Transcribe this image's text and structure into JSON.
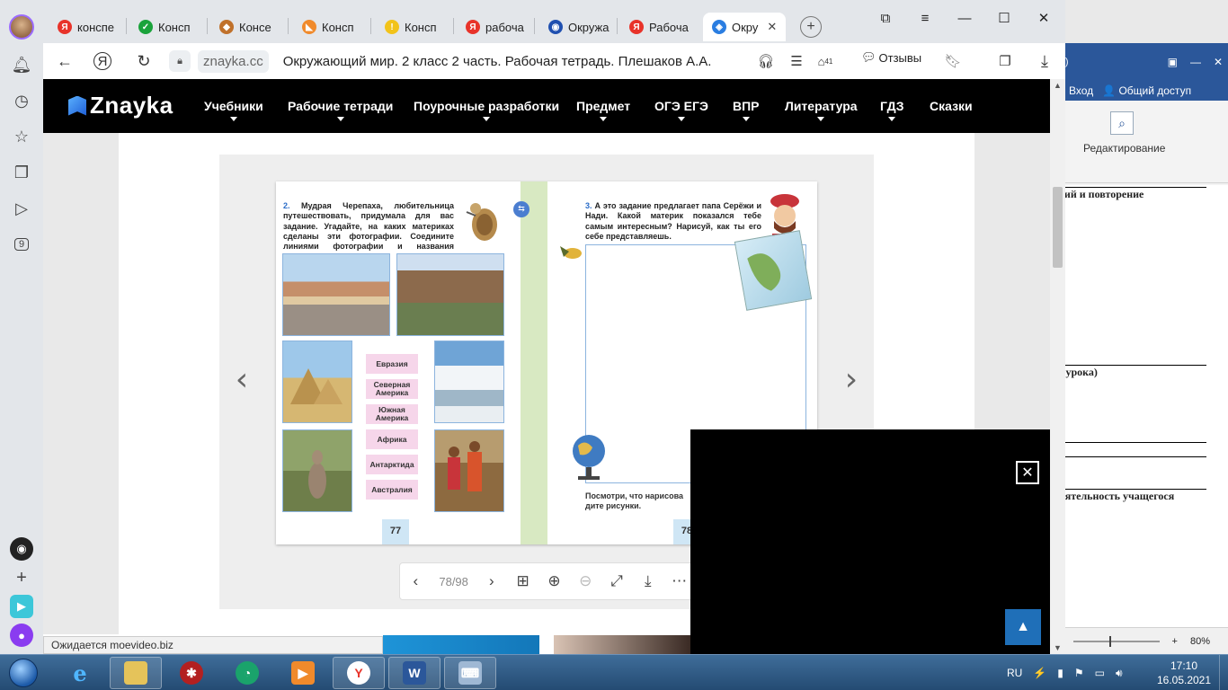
{
  "sidebar": {
    "badge_count": "9"
  },
  "tabs": [
    {
      "label": "конспе",
      "fav_color": "#e8332a",
      "fav_glyph": "Я"
    },
    {
      "label": "Консп",
      "fav_color": "#1aa33b",
      "fav_glyph": "✓"
    },
    {
      "label": "Консе",
      "fav_color": "#c0712b",
      "fav_glyph": "◆"
    },
    {
      "label": "Консп",
      "fav_color": "#f08a2b",
      "fav_glyph": "◣"
    },
    {
      "label": "Консп",
      "fav_color": "#f2c31a",
      "fav_glyph": "!"
    },
    {
      "label": "рабоча",
      "fav_color": "#e8332a",
      "fav_glyph": "Я"
    },
    {
      "label": "Окружа",
      "fav_color": "#2050b0",
      "fav_glyph": "◉"
    },
    {
      "label": "Рабоча",
      "fav_color": "#e8332a",
      "fav_glyph": "Я"
    },
    {
      "label": "Окру",
      "fav_color": "#2a7de1",
      "fav_glyph": "◈"
    }
  ],
  "address": {
    "host": "znayka.cc",
    "title": "Окружающий мир. 2 класс 2 часть. Рабочая тетрадь. Плешаков А.А.",
    "notif_count": "41",
    "reviews": "Отзывы"
  },
  "site": {
    "logo": "Znayka",
    "nav": [
      "Учебники",
      "Рабочие тетради",
      "Поурочные разработки",
      "Предмет",
      "ОГЭ ЕГЭ",
      "ВПР",
      "Литература",
      "ГДЗ",
      "Сказки"
    ]
  },
  "book": {
    "left_task_num": "2.",
    "left_task": "Мудрая Черепаха, любительница путешествовать, придумала для вас задание. Угадайте, на каких материках сделаны эти фотографии. Соедините линиями фотографии и названия материков.",
    "continents": [
      "Евразия",
      "Северная Америка",
      "Южная Америка",
      "Африка",
      "Антарктида",
      "Австралия"
    ],
    "left_page_num": "77",
    "right_task_num": "3.",
    "right_task": "А это задание предлагает папа Серёжи и Нади. Какой материк показался тебе самым интересным? Нарисуй, как ты его себе представляешь.",
    "hint": "Посмотри, что нарисова",
    "hint2": "дите рисунки.",
    "right_page_num": "78"
  },
  "viewer": {
    "pages": "78/98"
  },
  "status": {
    "loading": "Ожидается moevideo.biz"
  },
  "word": {
    "login": "Вход",
    "share": "Общий доступ",
    "editing": "Редактирование",
    "row1": "аний и повторение",
    "row2": "ог урока)",
    "row3": "Деятельность учащегося",
    "zoom": "80%",
    "title_frag": "га)"
  },
  "taskbar": {
    "lang": "RU",
    "time": "17:10",
    "date": "16.05.2021"
  }
}
